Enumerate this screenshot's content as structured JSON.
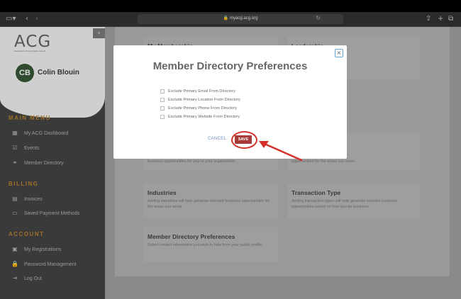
{
  "browser": {
    "url": "myacg.acg.org"
  },
  "sidebar": {
    "logo": "ACG",
    "logo_tagline": "Association for Corporate Growth",
    "user": {
      "initials": "CB",
      "name": "Colin Blouin"
    },
    "sections": [
      {
        "title": "MAIN MENU",
        "items": [
          {
            "label": "My ACG Dashboard",
            "icon": "dashboard-icon"
          },
          {
            "label": "Events",
            "icon": "calendar-check-icon"
          },
          {
            "label": "Member Directory",
            "icon": "handshake-icon"
          }
        ]
      },
      {
        "title": "BILLING",
        "items": [
          {
            "label": "Invoices",
            "icon": "invoice-icon"
          },
          {
            "label": "Saved Payment Methods",
            "icon": "credit-card-icon"
          }
        ]
      },
      {
        "title": "ACCOUNT",
        "items": [
          {
            "label": "My Registrations",
            "icon": "registration-icon"
          },
          {
            "label": "Password Management",
            "icon": "lock-icon"
          },
          {
            "label": "Log Out",
            "icon": "logout-icon"
          }
        ]
      }
    ]
  },
  "cards": [
    {
      "title": "My Membership",
      "desc": ""
    },
    {
      "title": "Leadership",
      "desc": ""
    },
    {
      "title": "",
      "desc": "business opportunities for you or your organization."
    },
    {
      "title": "",
      "desc": "opportunities for the areas you serve."
    },
    {
      "title": "Industries",
      "desc": "Adding industries will help generate relevant business opportunities for the areas you serve."
    },
    {
      "title": "Transaction Type",
      "desc": "Adding transaction types will help generate relevant business opportunities based on how you do business."
    },
    {
      "title": "Member Directory Preferences",
      "desc": "Select contact information you wish to hide from your public profile."
    }
  ],
  "modal": {
    "title": "Member Directory Preferences",
    "options": [
      "Exclude Primary Email From Directory",
      "Exclude Primary Location From Directory",
      "Exclude Primary Phone From Directory",
      "Exclude Primary Website From Directory"
    ],
    "cancel_label": "CANCEL",
    "save_label": "SAVE",
    "close_label": "×"
  },
  "colors": {
    "accent_gold": "#a0702c",
    "save_red": "#a83a3a",
    "annotation_red": "#d4312a"
  }
}
